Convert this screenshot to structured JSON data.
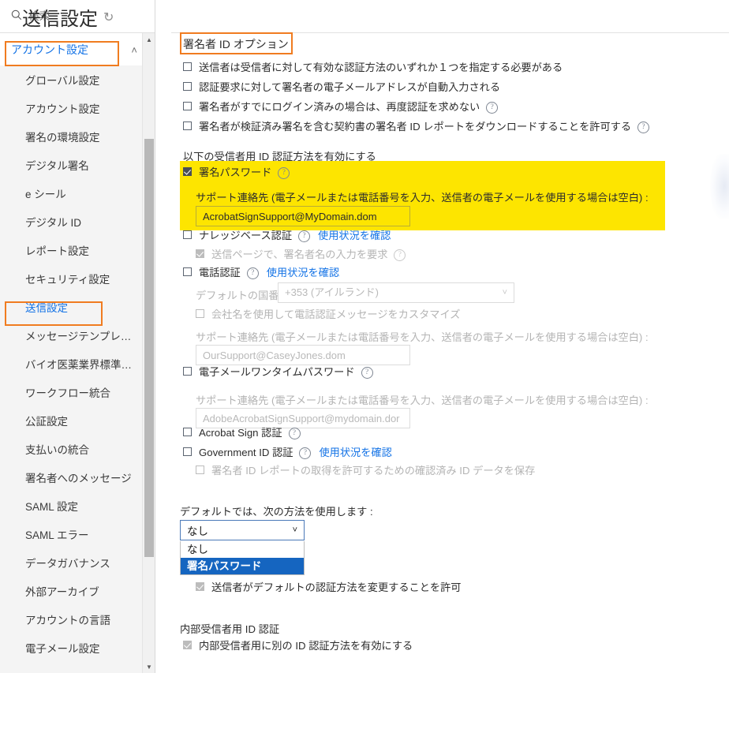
{
  "sidebar": {
    "search": {
      "placeholder": "検索",
      "icon": "search-icon"
    },
    "account_header": {
      "label": "アカウント設定",
      "chevron": "˄"
    },
    "items": [
      {
        "label": "グローバル設定"
      },
      {
        "label": "アカウント設定"
      },
      {
        "label": "署名の環境設定"
      },
      {
        "label": "デジタル署名"
      },
      {
        "label": "e シール"
      },
      {
        "label": "デジタル ID"
      },
      {
        "label": "レポート設定"
      },
      {
        "label": "セキュリティ設定"
      },
      {
        "label": "送信設定"
      },
      {
        "label": "メッセージテンプレ…"
      },
      {
        "label": "バイオ医薬業界標準…"
      },
      {
        "label": "ワークフロー統合"
      },
      {
        "label": "公証設定"
      },
      {
        "label": "支払いの統合"
      },
      {
        "label": "署名者へのメッセージ"
      },
      {
        "label": "SAML 設定"
      },
      {
        "label": "SAML エラー"
      },
      {
        "label": "データガバナンス"
      },
      {
        "label": "外部アーカイブ"
      },
      {
        "label": "アカウントの言語"
      },
      {
        "label": "電子メール設定"
      }
    ],
    "scroll_up_icon": "▲",
    "scroll_down_icon": "▼"
  },
  "main": {
    "title": "送信設定",
    "refresh_icon": "↻",
    "section_signer_id": "署名者 ID オプション",
    "top_options": [
      {
        "label": "送信者は受信者に対して有効な認証方法のいずれか１つを指定する必要がある",
        "checked": false,
        "info": false
      },
      {
        "label": "認証要求に対して署名者の電子メールアドレスが自動入力される",
        "checked": false,
        "info": false
      },
      {
        "label": "署名者がすでにログイン済みの場合は、再度認証を求めない",
        "checked": false,
        "info": true
      },
      {
        "label": "署名者が検証済み署名を含む契約書の署名者 ID レポートをダウンロードすることを許可する",
        "checked": false,
        "info": true
      }
    ],
    "enable_methods_heading": "以下の受信者用 ID 認証方法を有効にする",
    "signing_password": {
      "label": "署名パスワード",
      "checked": true,
      "support_label": "サポート連絡先 (電子メールまたは電話番号を入力、送信者の電子メールを使用する場合は空白) :",
      "support_value": "AcrobatSignSupport@MyDomain.dom"
    },
    "kba": {
      "label": "ナレッジベース認証",
      "checked": false,
      "link": "使用状況を確認",
      "sub_label": "送信ページで、署名者名の入力を要求",
      "sub_checked": true
    },
    "phone": {
      "label": "電話認証",
      "checked": false,
      "link": "使用状況を確認",
      "country_label": "デフォルトの国番号 :",
      "country_value": "+353 (アイルランド)",
      "customize_label": "会社名を使用して電話認証メッセージをカスタマイズ",
      "customize_checked": false,
      "support_label": "サポート連絡先 (電子メールまたは電話番号を入力、送信者の電子メールを使用する場合は空白) :",
      "support_value": "OurSupport@CaseyJones.dom"
    },
    "email_otp": {
      "label": "電子メールワンタイムパスワード",
      "checked": false,
      "support_label": "サポート連絡先 (電子メールまたは電話番号を入力、送信者の電子メールを使用する場合は空白) :",
      "support_value": "AdobeAcrobatSignSupport@mydomain.dor"
    },
    "acrobat_sign_auth": {
      "label": "Acrobat Sign 認証",
      "checked": false
    },
    "gov_id": {
      "label": "Government ID 認証",
      "checked": false,
      "link": "使用状況を確認",
      "sub_label": "署名者 ID レポートの取得を許可するための確認済み ID データを保存",
      "sub_checked": false
    },
    "default_method": {
      "heading": "デフォルトでは、次の方法を使用します :",
      "selected": "なし",
      "caret": "˅",
      "options": [
        {
          "label": "なし",
          "highlighted": false
        },
        {
          "label": "署名パスワード",
          "highlighted": true
        }
      ],
      "allow_change_label": "送信者がデフォルトの認証方法を変更することを許可",
      "allow_change_checked": true
    },
    "internal": {
      "heading": "内部受信者用 ID 認証",
      "label": "内部受信者用に別の ID 認証方法を有効にする",
      "checked": true
    }
  },
  "colors": {
    "highlight_box": "#f07c20",
    "yellow_highlight": "#FDE500",
    "link_blue": "#1473e6",
    "select_blue": "#1565c0"
  }
}
